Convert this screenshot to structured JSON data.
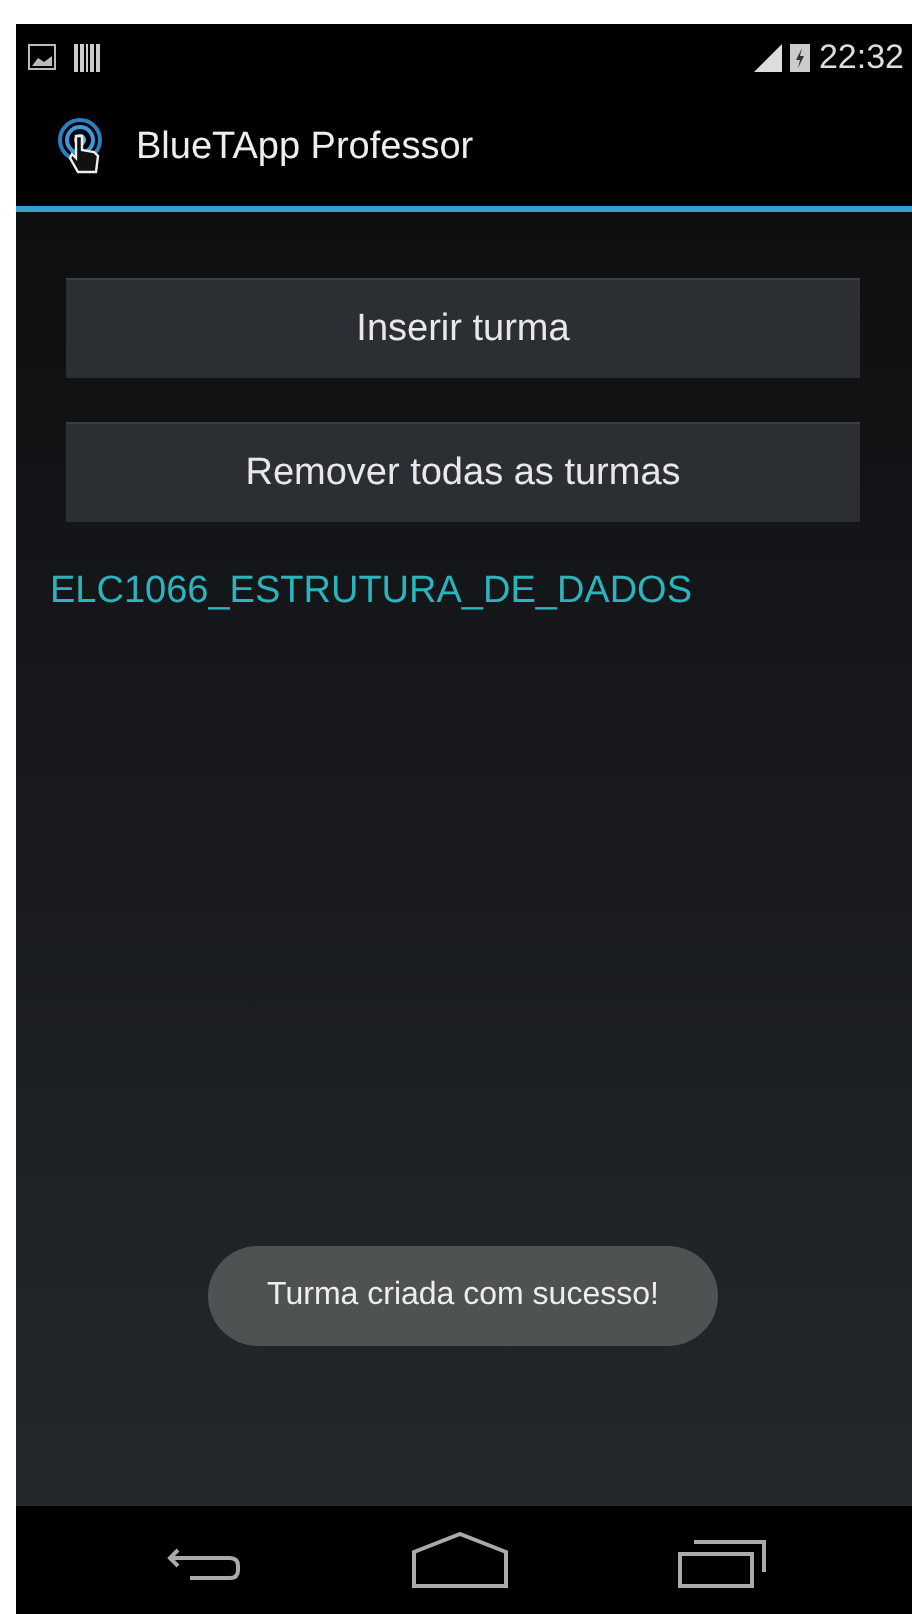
{
  "status_bar": {
    "time": "22:32"
  },
  "action_bar": {
    "title": "BlueTApp Professor"
  },
  "buttons": [
    {
      "label": "Inserir turma"
    },
    {
      "label": "Remover todas as turmas"
    }
  ],
  "classes": [
    {
      "label": "ELC1066_ESTRUTURA_DE_DADOS"
    }
  ],
  "toast": {
    "text": "Turma criada com sucesso!"
  }
}
